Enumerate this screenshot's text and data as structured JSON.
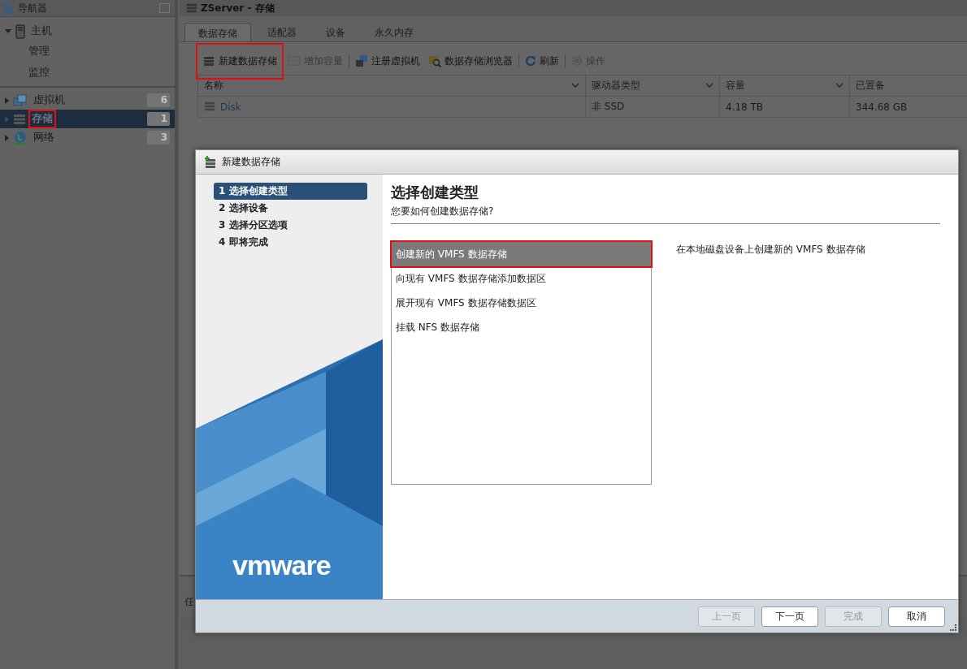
{
  "navigator": {
    "title": "导航器",
    "items": [
      {
        "label": "主机",
        "kind": "host",
        "expanded": true,
        "selected": false,
        "annotated": false,
        "children": [
          {
            "label": "管理"
          },
          {
            "label": "监控"
          }
        ]
      },
      {
        "label": "虚拟机",
        "kind": "vms",
        "expanded": false,
        "selected": false,
        "annotated": false,
        "count": "6"
      },
      {
        "label": "存储",
        "kind": "storage",
        "expanded": false,
        "selected": true,
        "annotated": true,
        "count": "1"
      },
      {
        "label": "网络",
        "kind": "network",
        "expanded": false,
        "selected": false,
        "annotated": false,
        "count": "3"
      }
    ]
  },
  "main": {
    "title": "ZServer - 存储",
    "tabs": [
      {
        "label": "数据存储",
        "selected": true
      },
      {
        "label": "适配器",
        "selected": false
      },
      {
        "label": "设备",
        "selected": false
      },
      {
        "label": "永久内存",
        "selected": false
      }
    ],
    "toolbar": [
      {
        "label": "新建数据存储",
        "kind": "new",
        "disabled": false,
        "annotated": true
      },
      {
        "label": "增加容量",
        "kind": "grow",
        "disabled": true,
        "annotated": false
      },
      {
        "label": "注册虚拟机",
        "kind": "register",
        "disabled": false,
        "annotated": false
      },
      {
        "label": "数据存储浏览器",
        "kind": "browse",
        "disabled": false,
        "annotated": false
      },
      {
        "label": "刷新",
        "kind": "refresh",
        "disabled": false,
        "annotated": false
      },
      {
        "label": "操作",
        "kind": "actions",
        "disabled": true,
        "annotated": false
      }
    ],
    "table": {
      "columns": [
        "名称",
        "驱动器类型",
        "容量",
        "已置备"
      ],
      "rows": [
        [
          "Disk",
          "非 SSD",
          "4.18 TB",
          "344.68 GB"
        ]
      ]
    },
    "tasks_panel": {
      "column_1": "任"
    }
  },
  "dialog": {
    "title": "新建数据存储",
    "steps": [
      {
        "label": "1 选择创建类型",
        "selected": true
      },
      {
        "label": "2 选择设备",
        "selected": false
      },
      {
        "label": "3 选择分区选项",
        "selected": false
      },
      {
        "label": "4 即将完成",
        "selected": false
      }
    ],
    "logo": "vmware",
    "heading": "选择创建类型",
    "subheading": "您要如何创建数据存储?",
    "options": [
      {
        "label": "创建新的 VMFS 数据存储",
        "selected": true,
        "annotated": true
      },
      {
        "label": "向现有 VMFS 数据存储添加数据区",
        "selected": false,
        "annotated": false
      },
      {
        "label": "展开现有 VMFS 数据存储数据区",
        "selected": false,
        "annotated": false
      },
      {
        "label": "挂载 NFS 数据存储",
        "selected": false,
        "annotated": false
      }
    ],
    "description": "在本地磁盘设备上创建新的 VMFS 数据存储",
    "buttons": [
      {
        "label": "上一页",
        "disabled": true
      },
      {
        "label": "下一页",
        "disabled": false
      },
      {
        "label": "完成",
        "disabled": true
      },
      {
        "label": "取消",
        "disabled": false
      }
    ]
  }
}
